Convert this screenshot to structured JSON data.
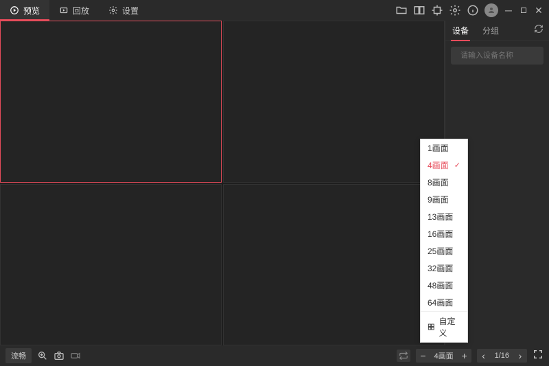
{
  "titlebar": {
    "tabs": [
      {
        "label": "预览",
        "active": true
      },
      {
        "label": "回放",
        "active": false
      },
      {
        "label": "设置",
        "active": false
      }
    ]
  },
  "right_panel": {
    "tabs": {
      "devices": "设备",
      "groups": "分组"
    },
    "search_placeholder": "请输入设备名称"
  },
  "bottombar": {
    "stream_label": "流畅",
    "layout_label": "4画面",
    "page_label": "1/16"
  },
  "layout_menu": {
    "items": [
      "1画面",
      "4画面",
      "8画面",
      "9画面",
      "13画面",
      "16画面",
      "25画面",
      "32画面",
      "48画面",
      "64画面"
    ],
    "selected": "4画面",
    "custom_label": "自定义"
  }
}
